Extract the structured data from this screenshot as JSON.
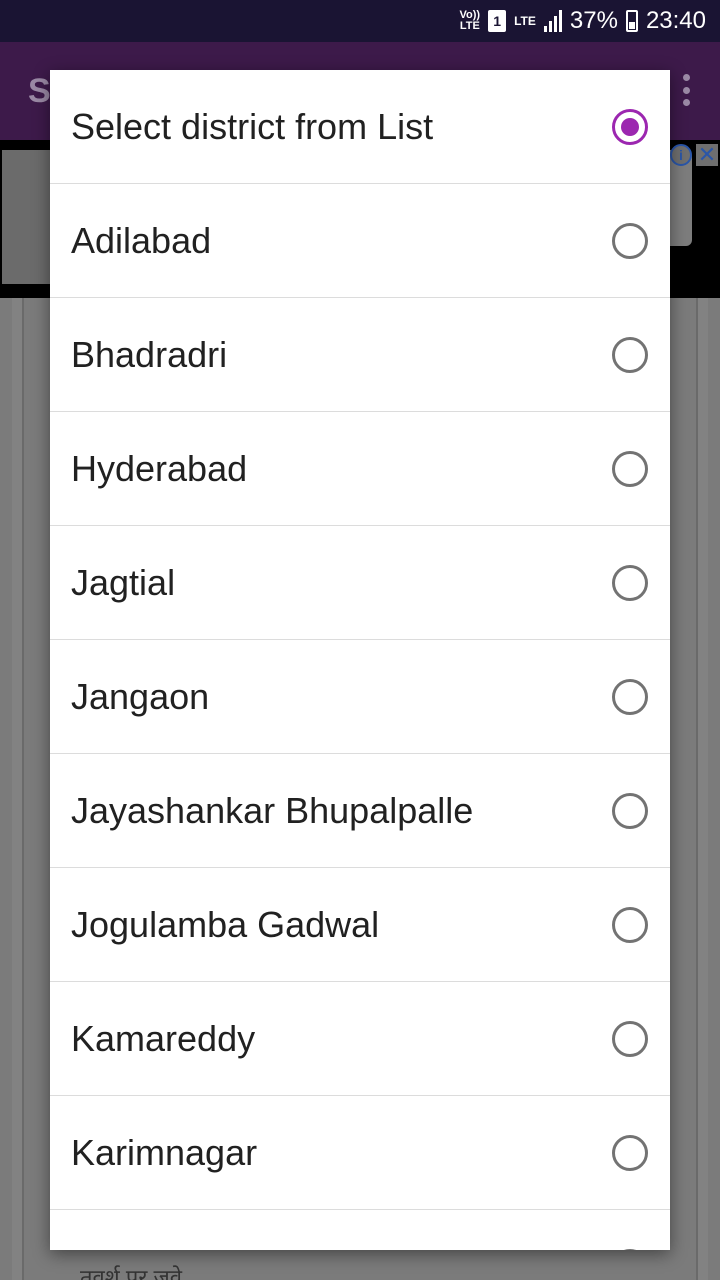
{
  "status_bar": {
    "volte_line1": "Vo))",
    "volte_line2": "LTE",
    "sim": "1",
    "lte": "LTE",
    "battery": "37%",
    "time": "23:40"
  },
  "app_bar": {
    "title": "S"
  },
  "ad": {
    "info_icon": "info-icon",
    "close_icon": "close-icon"
  },
  "background_hint": "तवर्श पर जवे",
  "dialog": {
    "accent_color": "#9c27b0",
    "options": [
      {
        "label": "Select district from List",
        "checked": true
      },
      {
        "label": "Adilabad",
        "checked": false
      },
      {
        "label": "Bhadradri",
        "checked": false
      },
      {
        "label": "Hyderabad",
        "checked": false
      },
      {
        "label": "Jagtial",
        "checked": false
      },
      {
        "label": "Jangaon",
        "checked": false
      },
      {
        "label": "Jayashankar Bhupalpalle",
        "checked": false
      },
      {
        "label": "Jogulamba Gadwal",
        "checked": false
      },
      {
        "label": "Kamareddy",
        "checked": false
      },
      {
        "label": "Karimnagar",
        "checked": false
      },
      {
        "label": "",
        "checked": false
      }
    ]
  }
}
